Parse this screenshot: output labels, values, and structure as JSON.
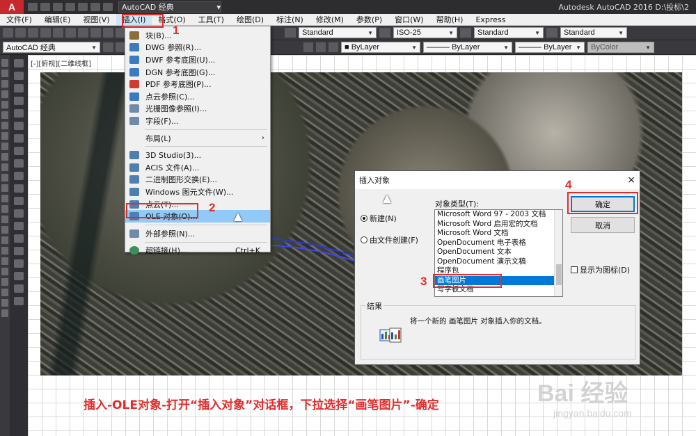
{
  "titlebar": {
    "logo": "A",
    "workspace": "AutoCAD 经典",
    "title": "Autodesk AutoCAD 2016    D:\\投标\\2"
  },
  "menubar": {
    "items": [
      "文件(F)",
      "编辑(E)",
      "视图(V)",
      "插入(I)",
      "格式(O)",
      "工具(T)",
      "绘图(D)",
      "标注(N)",
      "修改(M)",
      "参数(P)",
      "窗口(W)",
      "帮助(H)",
      "Express"
    ]
  },
  "toolbar": {
    "text_style": "Standard",
    "dim_style": "ISO-25",
    "table_style": "Standard",
    "mleader_style": "Standard",
    "workspace": "AutoCAD 经典",
    "layer_color": "ByLayer",
    "linetype": "ByLayer",
    "lineweight": "ByLayer",
    "plot_style": "ByColor"
  },
  "viewport": {
    "label": "[-][俯视][二维线框]"
  },
  "insert_menu": {
    "items": [
      {
        "label": "块(B)...",
        "color": "#8a6d3b"
      },
      {
        "label": "DWG 参照(R)...",
        "color": "#3b7bbf"
      },
      {
        "label": "DWF 参考底图(U)...",
        "color": "#3b7bbf"
      },
      {
        "label": "DGN 参考底图(G)...",
        "color": "#3b7bbf"
      },
      {
        "label": "PDF 参考底图(P)...",
        "color": "#d03a2f"
      },
      {
        "label": "点云参照(C)...",
        "color": "#3b7bbf"
      },
      {
        "label": "光栅图像参照(I)...",
        "color": "#6e8ca8"
      },
      {
        "label": "字段(F)...",
        "color": "#6e8ca8"
      }
    ],
    "layout_item": {
      "label": "布局(L)",
      "submenu": "›"
    },
    "items2": [
      {
        "label": "3D Studio(3)...",
        "color": "#4d7fb0"
      },
      {
        "label": "ACIS 文件(A)...",
        "color": "#4d7fb0"
      },
      {
        "label": "二进制图形交换(E)...",
        "color": "#4d7fb0"
      },
      {
        "label": "Windows 图元文件(W)...",
        "color": "#4d7fb0"
      },
      {
        "label": "点云(T)...",
        "color": "#4d7fb0"
      }
    ],
    "ole_item": {
      "label": "OLE 对象(O)..."
    },
    "xref_item": {
      "label": "外部参照(N)..."
    },
    "hyperlink_item": {
      "label": "超链接(H)...",
      "shortcut": "Ctrl+K"
    }
  },
  "markers": {
    "m1": "1",
    "m2": "2",
    "m3": "3",
    "m4": "4"
  },
  "dialog": {
    "title": "插入对象",
    "close": "×",
    "radio_new": "新建(N)",
    "radio_file": "由文件创建(F)",
    "type_label": "对象类型(T):",
    "types": [
      "Microsoft Word 97 - 2003 文档",
      "Microsoft Word 启用宏的文档",
      "Microsoft Word 文档",
      "OpenDocument 电子表格",
      "OpenDocument 文本",
      "OpenDocument 演示文稿",
      "程序包",
      "画笔图片",
      "写字板文档"
    ],
    "selected_index": 7,
    "ok": "确定",
    "cancel": "取消",
    "show_as_icon": "显示为图标(D)",
    "result_label": "结果",
    "result_text": "将一个新的 画笔图片 对象插入你的文档。"
  },
  "caption": "插入-OLE对象-打开“插入对象”对话框，下拉选择“画笔图片”-确定",
  "watermark": {
    "main": "Bai 经验",
    "url": "jingyan.baidu.com"
  }
}
